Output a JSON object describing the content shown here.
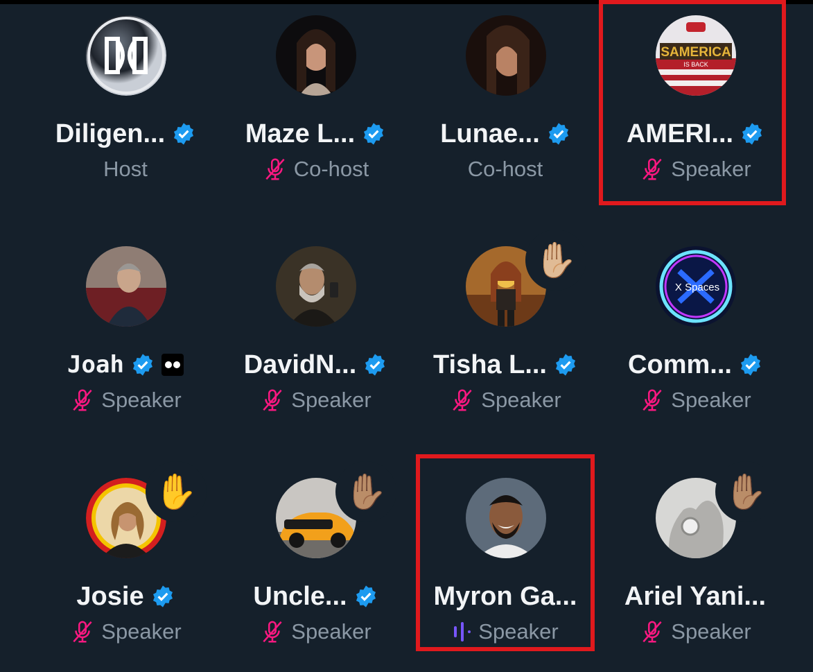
{
  "participants": [
    {
      "name": "Diligen...",
      "role": "Host",
      "verified": true,
      "muted": false,
      "hand": "",
      "avatar": "logo-d"
    },
    {
      "name": "Maze L...",
      "role": "Co-host",
      "verified": true,
      "muted": true,
      "hand": "",
      "avatar": "woman"
    },
    {
      "name": "Lunae...",
      "role": "Co-host",
      "verified": true,
      "muted": false,
      "hand": "",
      "avatar": "woman-dark"
    },
    {
      "name": "AMERI...",
      "role": "Speaker",
      "verified": true,
      "muted": true,
      "hand": "",
      "avatar": "america"
    },
    {
      "name": "Joah",
      "role": "Speaker",
      "verified": true,
      "muted": true,
      "hand": "",
      "avatar": "man-car"
    },
    {
      "name": "DavidN...",
      "role": "Speaker",
      "verified": true,
      "muted": true,
      "hand": "",
      "avatar": "man-beard"
    },
    {
      "name": "Tisha L...",
      "role": "Speaker",
      "verified": true,
      "muted": true,
      "hand": "✋🏼",
      "avatar": "lego-woman"
    },
    {
      "name": "Comm...",
      "role": "Speaker",
      "verified": true,
      "muted": true,
      "hand": "",
      "avatar": "xspaces"
    },
    {
      "name": "Josie",
      "role": "Speaker",
      "verified": true,
      "muted": true,
      "hand": "✋",
      "avatar": "woman-yellow"
    },
    {
      "name": "Uncle...",
      "role": "Speaker",
      "verified": true,
      "muted": true,
      "hand": "✋🏽",
      "avatar": "orange-car"
    },
    {
      "name": "Myron Ga...",
      "role": "Speaker",
      "verified": false,
      "muted": false,
      "speaking": true,
      "hand": "",
      "avatar": "man-smile"
    },
    {
      "name": "Ariel Yani...",
      "role": "Speaker",
      "verified": false,
      "muted": true,
      "hand": "✋🏽",
      "avatar": "hand-ring"
    }
  ],
  "xspaces_logo_text": "X Spaces",
  "america_logo_text": "SAMERICA",
  "america_logo_sub": "IS BACK",
  "colors": {
    "background": "#15202b",
    "verified": "#1d9bf0",
    "muted_mic": "#f91880",
    "speaking": "#7856ff",
    "highlight": "#e0191d"
  }
}
